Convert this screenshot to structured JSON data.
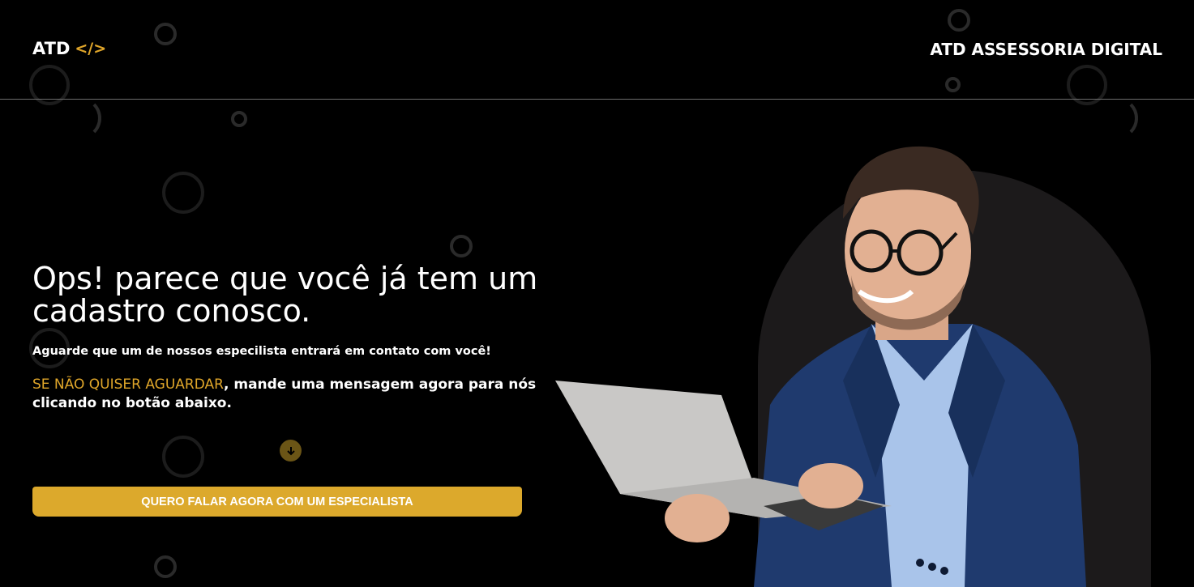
{
  "header": {
    "logo_text": "ATD",
    "logo_code": "</>",
    "brand_name": "ATD ASSESSORIA DIGITAL"
  },
  "hero": {
    "headline": "Ops! parece que você já tem um cadastro conosco.",
    "subtitle": "Aguarde que um de nossos especilista entrará em contato com você!",
    "cta_accent": "SE NÃO QUISER AGUARDAR",
    "cta_rest": ", mande uma mensagem agora para nós clicando no botão abaixo.",
    "button_label": "QUERO FALAR AGORA COM UM ESPECIALISTA"
  },
  "colors": {
    "background": "#000000",
    "accent": "#e0a62a",
    "button": "#dca92c",
    "arch": "#1c1a1b"
  },
  "icons": {
    "arrow": "arrow-down-icon",
    "code": "code-icon"
  }
}
